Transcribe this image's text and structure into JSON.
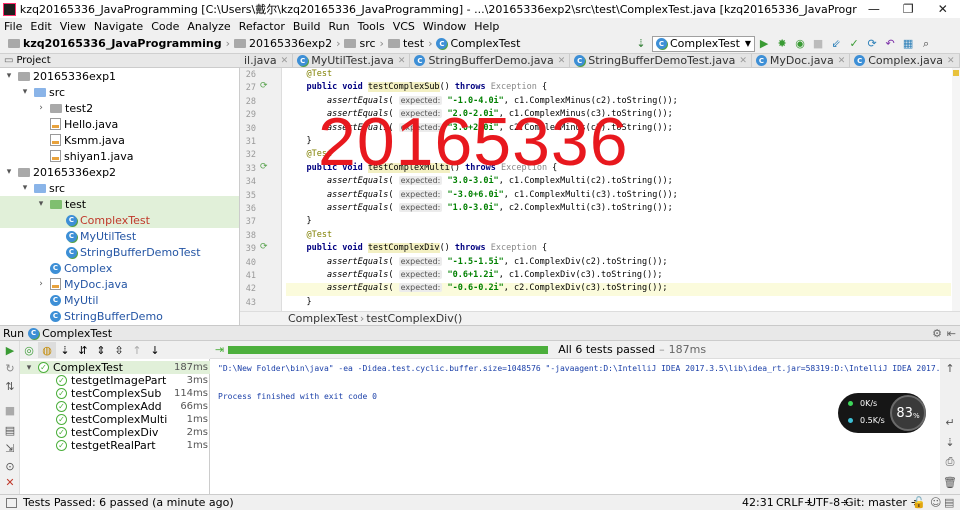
{
  "window": {
    "title": "kzq20165336_JavaProgramming [C:\\Users\\戴尔\\kzq20165336_JavaProgramming] - ...\\20165336exp2\\src\\test\\ComplexTest.java [kzq20165336_JavaProgramming] - IntelliJ IDEA",
    "minimize": "—",
    "maximize": "❐",
    "close": "✕"
  },
  "menu": [
    "File",
    "Edit",
    "View",
    "Navigate",
    "Code",
    "Analyze",
    "Refactor",
    "Build",
    "Run",
    "Tools",
    "VCS",
    "Window",
    "Help"
  ],
  "breadcrumb": [
    "kzq20165336_JavaProgramming",
    "20165336exp2",
    "src",
    "test",
    "ComplexTest"
  ],
  "run_config": "ComplexTest",
  "project_panel": {
    "title": "Project",
    "tree": [
      {
        "label": "20165336exp1",
        "indent": 1,
        "arrow": "▾",
        "icon": "folder"
      },
      {
        "label": "src",
        "indent": 2,
        "arrow": "▾",
        "icon": "folder"
      },
      {
        "label": "test2",
        "indent": 3,
        "arrow": "›",
        "icon": "folder"
      },
      {
        "label": "Hello.java",
        "indent": 3,
        "arrow": "",
        "icon": "file"
      },
      {
        "label": "Ksmm.java",
        "indent": 3,
        "arrow": "",
        "icon": "file"
      },
      {
        "label": "shiyan1.java",
        "indent": 3,
        "arrow": "",
        "icon": "file"
      },
      {
        "label": "20165336exp2",
        "indent": 1,
        "arrow": "▾",
        "icon": "folder"
      },
      {
        "label": "src",
        "indent": 2,
        "arrow": "▾",
        "icon": "folder"
      },
      {
        "label": "test",
        "indent": 3,
        "arrow": "▾",
        "icon": "folder",
        "selected": true
      },
      {
        "label": "ComplexTest",
        "indent": 4,
        "arrow": "",
        "icon": "class",
        "selected": true,
        "color": "#c0392b"
      },
      {
        "label": "MyUtilTest",
        "indent": 4,
        "arrow": "",
        "icon": "class",
        "color": "#2455a4"
      },
      {
        "label": "StringBufferDemoTest",
        "indent": 4,
        "arrow": "",
        "icon": "class",
        "color": "#2455a4"
      },
      {
        "label": "Complex",
        "indent": 3,
        "arrow": "",
        "icon": "class",
        "color": "#2455a4"
      },
      {
        "label": "MyDoc.java",
        "indent": 3,
        "arrow": "›",
        "icon": "file",
        "color": "#2455a4"
      },
      {
        "label": "MyUtil",
        "indent": 3,
        "arrow": "",
        "icon": "class",
        "color": "#2455a4"
      },
      {
        "label": "StringBufferDemo",
        "indent": 3,
        "arrow": "",
        "icon": "class",
        "color": "#2455a4"
      }
    ]
  },
  "editor_tabs": [
    {
      "label": "il.java",
      "active": false
    },
    {
      "label": "MyUtilTest.java",
      "active": false
    },
    {
      "label": "StringBufferDemo.java",
      "active": false
    },
    {
      "label": "StringBufferDemoTest.java",
      "active": false
    },
    {
      "label": "MyDoc.java",
      "active": false
    },
    {
      "label": "Complex.java",
      "active": false
    },
    {
      "label": "ComplexTest.java",
      "active": true
    }
  ],
  "code_lines": [
    {
      "n": "26",
      "html": "    <span class='ann'>@Test</span>"
    },
    {
      "n": "27",
      "html": "    <span class='kw'>public void</span> <span class='mhl'>testComplexSub</span>() <span class='kw'>throws</span> <span class='gray'>Exception</span> {",
      "run": true
    },
    {
      "n": "28",
      "html": "        <span class='itl'>assertEquals</span>( <span class='hint'>expected:</span> <span class='str'>\"-1.0-4.0i\"</span>, c1.ComplexMinus(c2).toString());"
    },
    {
      "n": "29",
      "html": "        <span class='itl'>assertEquals</span>( <span class='hint'>expected:</span> <span class='str'>\"2.0-2.0i\"</span>, c1.ComplexMinus(c3).toString());"
    },
    {
      "n": "30",
      "html": "        <span class='itl'>assertEquals</span>( <span class='hint'>expected:</span> <span class='str'>\"3.0+2.0i\"</span>, c2.ComplexMinus(c3).toString());"
    },
    {
      "n": "31",
      "html": "    }"
    },
    {
      "n": "32",
      "html": "    <span class='ann'>@Test</span>"
    },
    {
      "n": "33",
      "html": "    <span class='kw'>public void</span> <span class='mhl'>testComplexMulti</span>() <span class='kw'>throws</span> <span class='gray'>Exception</span> {",
      "run": true
    },
    {
      "n": "34",
      "html": "        <span class='itl'>assertEquals</span>( <span class='hint'>expected:</span> <span class='str'>\"3.0-3.0i\"</span>, c1.ComplexMulti(c2).toString());"
    },
    {
      "n": "35",
      "html": "        <span class='itl'>assertEquals</span>( <span class='hint'>expected:</span> <span class='str'>\"-3.0+6.0i\"</span>, c1.ComplexMulti(c3).toString());"
    },
    {
      "n": "36",
      "html": "        <span class='itl'>assertEquals</span>( <span class='hint'>expected:</span> <span class='str'>\"1.0-3.0i\"</span>, c2.ComplexMulti(c3).toString());"
    },
    {
      "n": "37",
      "html": "    }"
    },
    {
      "n": "38",
      "html": "    <span class='ann'>@Test</span>"
    },
    {
      "n": "39",
      "html": "    <span class='kw'>public void</span> <span class='mhl'>testComplexDiv</span>() <span class='kw'>throws</span> <span class='gray'>Exception</span> {",
      "run": true
    },
    {
      "n": "40",
      "html": "        <span class='itl'>assertEquals</span>( <span class='hint'>expected:</span> <span class='str'>\"-1.5-1.5i\"</span>, c1.ComplexDiv(c2).toString());"
    },
    {
      "n": "41",
      "html": "        <span class='itl'>assertEquals</span>( <span class='hint'>expected:</span> <span class='str'>\"0.6+1.2i\"</span>, c1.ComplexDiv(c3).toString());"
    },
    {
      "n": "42",
      "html": "        <span class='itl'>assertEquals</span>( <span class='hint'>expected:</span> <span class='str'>\"-0.6-0.2i\"</span>, c2.ComplexDiv(c3).toString());",
      "current": true
    },
    {
      "n": "43",
      "html": "    }"
    }
  ],
  "watermark": "20165336",
  "editor_breadcrumb": {
    "cls": "ComplexTest",
    "method": "testComplexDiv()"
  },
  "run_panel": {
    "label": "Run",
    "config": "ComplexTest",
    "status": "All 6 tests passed",
    "status_time": "187ms",
    "tests": [
      {
        "name": "ComplexTest",
        "time": "187ms",
        "root": true
      },
      {
        "name": "testgetImagePart",
        "time": "3ms"
      },
      {
        "name": "testComplexSub",
        "time": "114ms"
      },
      {
        "name": "testComplexAdd",
        "time": "66ms"
      },
      {
        "name": "testComplexMulti",
        "time": "1ms"
      },
      {
        "name": "testComplexDiv",
        "time": "2ms"
      },
      {
        "name": "testgetRealPart",
        "time": "1ms"
      }
    ],
    "console": [
      "\"D:\\New Folder\\bin\\java\" -ea -Didea.test.cyclic.buffer.size=1048576 \"-javaagent:D:\\IntelliJ IDEA 2017.3.5\\lib\\idea_rt.jar=58319:D:\\IntelliJ IDEA 2017.3.5\\bin\" -",
      "",
      "Process finished with exit code 0"
    ]
  },
  "net_widget": {
    "up": "0K/s",
    "down": "0.5K/s",
    "percent": "83",
    "percent_sign": "%"
  },
  "statusbar": {
    "message": "Tests Passed: 6 passed (a minute ago)",
    "position": "42:31",
    "line_sep": "CRLF÷",
    "encoding": "UTF-8÷",
    "git": "Git: master ÷"
  }
}
